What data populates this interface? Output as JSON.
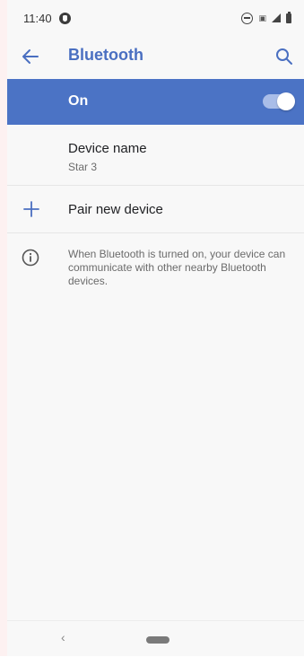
{
  "status_bar": {
    "time": "11:40",
    "icons": [
      "notification-app-icon",
      "dnd-icon",
      "sim-icon",
      "signal-icon",
      "battery-icon"
    ]
  },
  "app_bar": {
    "title": "Bluetooth",
    "back_icon": "arrow-back-icon",
    "search_icon": "search-icon",
    "accent_color": "#4a6fc1"
  },
  "bluetooth_toggle": {
    "label": "On",
    "state": "on",
    "background_color": "#4b73c5"
  },
  "device_name": {
    "title": "Device name",
    "value": "Star 3"
  },
  "pair_new_device": {
    "label": "Pair new device",
    "icon": "plus-icon"
  },
  "info": {
    "icon": "info-icon",
    "text": "When Bluetooth is turned on, your device can communicate with other nearby Bluetooth devices."
  },
  "nav_bar": {
    "back_glyph": "‹",
    "home_icon": "home-pill-icon"
  }
}
